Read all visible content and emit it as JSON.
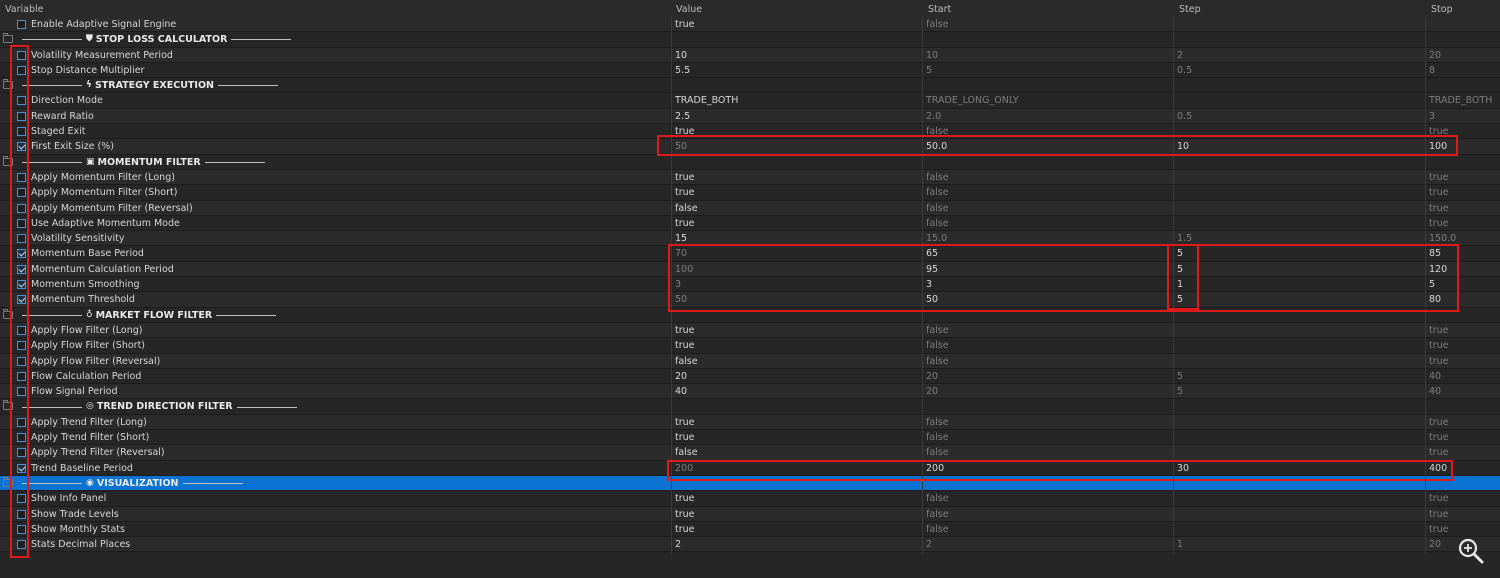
{
  "headers": {
    "variable": "Variable",
    "value": "Value",
    "start": "Start",
    "step": "Step",
    "stop": "Stop"
  },
  "rows": [
    {
      "kind": "param",
      "name": "Enable Adaptive Signal Engine",
      "checked": false,
      "value": "true",
      "start": "false",
      "step": "",
      "stop": ""
    },
    {
      "kind": "group",
      "title": "STOP LOSS CALCULATOR",
      "icon": "shield-icon",
      "symbol": "⛊"
    },
    {
      "kind": "param",
      "name": "Volatility Measurement Period",
      "checked": false,
      "value": "10",
      "start": "10",
      "step": "2",
      "stop": "20"
    },
    {
      "kind": "param",
      "name": "Stop Distance Multiplier",
      "checked": false,
      "value": "5.5",
      "start": "5",
      "step": "0.5",
      "stop": "8"
    },
    {
      "kind": "group",
      "title": "STRATEGY EXECUTION",
      "icon": "lightning-icon",
      "symbol": "ϟ"
    },
    {
      "kind": "param",
      "name": "Direction Mode",
      "checked": false,
      "value": "TRADE_BOTH",
      "start": "TRADE_LONG_ONLY",
      "step": "",
      "stop": "TRADE_BOTH"
    },
    {
      "kind": "param",
      "name": "Reward Ratio",
      "checked": false,
      "value": "2.5",
      "start": "2.0",
      "step": "0.5",
      "stop": "3"
    },
    {
      "kind": "param",
      "name": "Staged Exit",
      "checked": false,
      "value": "true",
      "start": "false",
      "step": "",
      "stop": "true"
    },
    {
      "kind": "param",
      "name": "First Exit Size (%)",
      "checked": true,
      "value": "50",
      "start": "50.0",
      "step": "10",
      "stop": "100"
    },
    {
      "kind": "group",
      "title": "MOMENTUM FILTER",
      "icon": "chart-icon",
      "symbol": "▣"
    },
    {
      "kind": "param",
      "name": "Apply Momentum Filter (Long)",
      "checked": false,
      "value": "true",
      "start": "false",
      "step": "",
      "stop": "true"
    },
    {
      "kind": "param",
      "name": "Apply Momentum Filter (Short)",
      "checked": false,
      "value": "true",
      "start": "false",
      "step": "",
      "stop": "true"
    },
    {
      "kind": "param",
      "name": "Apply Momentum Filter (Reversal)",
      "checked": false,
      "value": "false",
      "start": "false",
      "step": "",
      "stop": "true"
    },
    {
      "kind": "param",
      "name": "Use Adaptive Momentum Mode",
      "checked": false,
      "value": "true",
      "start": "false",
      "step": "",
      "stop": "true"
    },
    {
      "kind": "param",
      "name": "Volatility Sensitivity",
      "checked": false,
      "value": "15",
      "start": "15.0",
      "step": "1.5",
      "stop": "150.0"
    },
    {
      "kind": "param",
      "name": "Momentum Base Period",
      "checked": true,
      "value": "70",
      "start": "65",
      "step": "5",
      "stop": "85"
    },
    {
      "kind": "param",
      "name": "Momentum Calculation Period",
      "checked": true,
      "value": "100",
      "start": "95",
      "step": "5",
      "stop": "120"
    },
    {
      "kind": "param",
      "name": "Momentum Smoothing",
      "checked": true,
      "value": "3",
      "start": "3",
      "step": "1",
      "stop": "5"
    },
    {
      "kind": "param",
      "name": "Momentum Threshold",
      "checked": true,
      "value": "50",
      "start": "50",
      "step": "5",
      "stop": "80"
    },
    {
      "kind": "group",
      "title": "MARKET FLOW FILTER",
      "icon": "drop-icon",
      "symbol": "♁"
    },
    {
      "kind": "param",
      "name": "Apply Flow Filter (Long)",
      "checked": false,
      "value": "true",
      "start": "false",
      "step": "",
      "stop": "true"
    },
    {
      "kind": "param",
      "name": "Apply Flow Filter (Short)",
      "checked": false,
      "value": "true",
      "start": "false",
      "step": "",
      "stop": "true"
    },
    {
      "kind": "param",
      "name": "Apply Flow Filter (Reversal)",
      "checked": false,
      "value": "false",
      "start": "false",
      "step": "",
      "stop": "true"
    },
    {
      "kind": "param",
      "name": "Flow Calculation Period",
      "checked": false,
      "value": "20",
      "start": "20",
      "step": "5",
      "stop": "40"
    },
    {
      "kind": "param",
      "name": "Flow Signal Period",
      "checked": false,
      "value": "40",
      "start": "20",
      "step": "5",
      "stop": "40"
    },
    {
      "kind": "group",
      "title": "TREND DIRECTION FILTER",
      "icon": "target-icon",
      "symbol": "◎"
    },
    {
      "kind": "param",
      "name": "Apply Trend Filter (Long)",
      "checked": false,
      "value": "true",
      "start": "false",
      "step": "",
      "stop": "true"
    },
    {
      "kind": "param",
      "name": "Apply Trend Filter (Short)",
      "checked": false,
      "value": "true",
      "start": "false",
      "step": "",
      "stop": "true"
    },
    {
      "kind": "param",
      "name": "Apply Trend Filter (Reversal)",
      "checked": false,
      "value": "false",
      "start": "false",
      "step": "",
      "stop": "true"
    },
    {
      "kind": "param",
      "name": "Trend Baseline Period",
      "checked": true,
      "value": "200",
      "start": "200",
      "step": "30",
      "stop": "400"
    },
    {
      "kind": "group",
      "title": "VISUALIZATION",
      "icon": "eye-icon",
      "symbol": "◉",
      "selected": true
    },
    {
      "kind": "param",
      "name": "Show Info Panel",
      "checked": false,
      "value": "true",
      "start": "false",
      "step": "",
      "stop": "true"
    },
    {
      "kind": "param",
      "name": "Show Trade Levels",
      "checked": false,
      "value": "true",
      "start": "false",
      "step": "",
      "stop": "true"
    },
    {
      "kind": "param",
      "name": "Show Monthly Stats",
      "checked": false,
      "value": "true",
      "start": "false",
      "step": "",
      "stop": "true"
    },
    {
      "kind": "param",
      "name": "Stats Decimal Places",
      "checked": false,
      "value": "2",
      "start": "2",
      "step": "1",
      "stop": "20"
    }
  ]
}
